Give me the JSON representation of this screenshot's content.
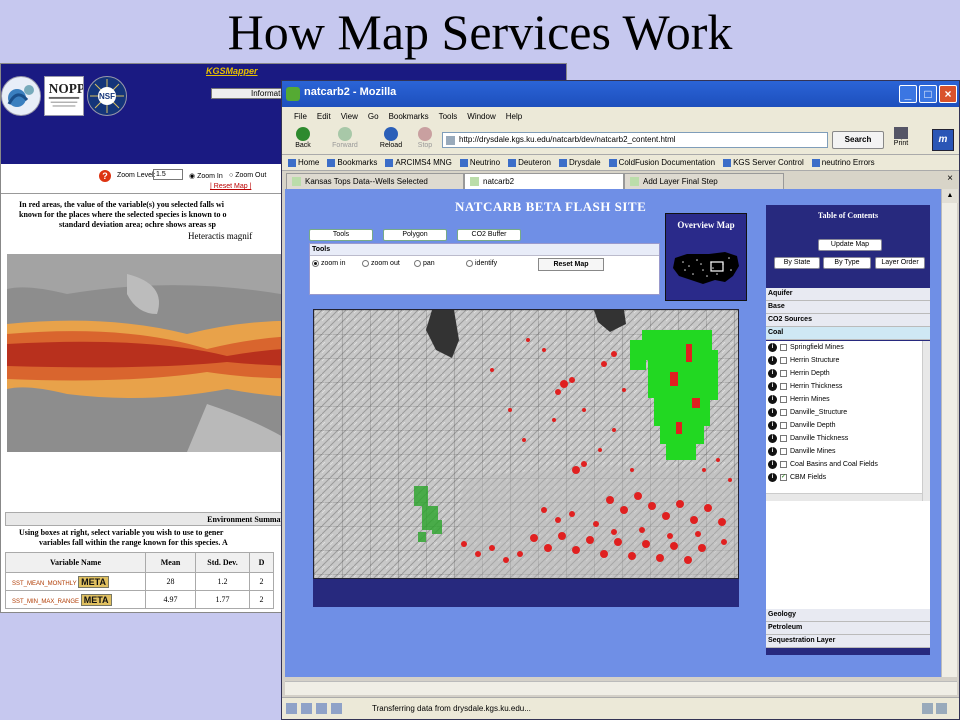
{
  "slide": {
    "title": "How Map Services Work"
  },
  "kgs": {
    "link": "KGSMapper",
    "info_button": "Information",
    "zoom_level_label": "Zoom Level:",
    "zoom_level_value": "1.5",
    "zoom_in_label": "Zoom In",
    "zoom_out_label": "Zoom Out",
    "reset_map": "| Reset Map |",
    "description_line1": "In red areas, the value of the variable(s) you selected falls wi",
    "description_line2": "known for the places where the selected species is known to o",
    "description_line3": "standard deviation area; ochre shows areas sp",
    "species": "Heteractis magnif",
    "stats_title": "Environment Summary Statistics (average, st",
    "stats_note_line1": "Using boxes at right, select variable you wish to use to gener",
    "stats_note_line2": "variables fall within the range known for this species. A",
    "table_headers": [
      "Variable Name",
      "Mean",
      "Std. Dev.",
      "D"
    ],
    "rows": [
      {
        "name": "SST_MEAN_MONTHLY",
        "meta": "META",
        "mean": "28",
        "sd": "1.2",
        "extra": "2"
      },
      {
        "name": "SST_MIN_MAX_RANGE",
        "meta": "META",
        "mean": "4.97",
        "sd": "1.77",
        "extra": "2"
      }
    ]
  },
  "browser": {
    "window_title": "natcarb2 - Mozilla",
    "menu": [
      "File",
      "Edit",
      "View",
      "Go",
      "Bookmarks",
      "Tools",
      "Window",
      "Help"
    ],
    "nav": {
      "back": "Back",
      "forward": "Forward",
      "reload": "Reload",
      "stop": "Stop",
      "print": "Print"
    },
    "url": "http://drysdale.kgs.ku.edu/natcarb/dev/natcarb2_content.html",
    "search_button": "Search",
    "bookmarks": [
      "Home",
      "Bookmarks",
      "ARCIMS4 MNG",
      "Neutrino",
      "Deuteron",
      "Drysdale",
      "ColdFusion Documentation",
      "KGS Server Control",
      "neutrino Errors"
    ],
    "tabs": [
      "Kansas Tops Data--Wells Selected",
      "natcarb2",
      "Add Layer Final Step"
    ],
    "status": "Transferring data from drysdale.kgs.ku.edu..."
  },
  "natcarb": {
    "site_title": "NATCARB BETA FLASH SITE",
    "buttons": {
      "tools": "Tools",
      "polygon": "Polygon",
      "co2_buffer": "CO2 Buffer",
      "reset_map": "Reset Map"
    },
    "tools_header": "Tools",
    "radios": {
      "zoom_in": "zoom in",
      "zoom_out": "zoom out",
      "pan": "pan",
      "identify": "identify"
    },
    "overview_title": "Overview Map",
    "toc": {
      "title": "Table of Contents",
      "update_map": "Update Map",
      "by_state": "By State",
      "by_type": "By Type",
      "layer_order": "Layer Order",
      "sections_top": [
        "Aquifer",
        "Base",
        "CO2 Sources",
        "Coal"
      ],
      "layers": [
        {
          "name": "Springfield Mines",
          "checked": false
        },
        {
          "name": "Herrin Structure",
          "checked": false
        },
        {
          "name": "Herrin Depth",
          "checked": false
        },
        {
          "name": "Herrin Thickness",
          "checked": false
        },
        {
          "name": "Herrin Mines",
          "checked": false
        },
        {
          "name": "Danville_Structure",
          "checked": false
        },
        {
          "name": "Danville Depth",
          "checked": false
        },
        {
          "name": "Danville Thickness",
          "checked": false
        },
        {
          "name": "Danville Mines",
          "checked": false
        },
        {
          "name": "Coal Basins and Coal Fields",
          "checked": false
        },
        {
          "name": "CBM Fields",
          "checked": true
        }
      ],
      "sections_bottom": [
        "Geology",
        "Petroleum",
        "Sequestration Layer"
      ]
    }
  }
}
